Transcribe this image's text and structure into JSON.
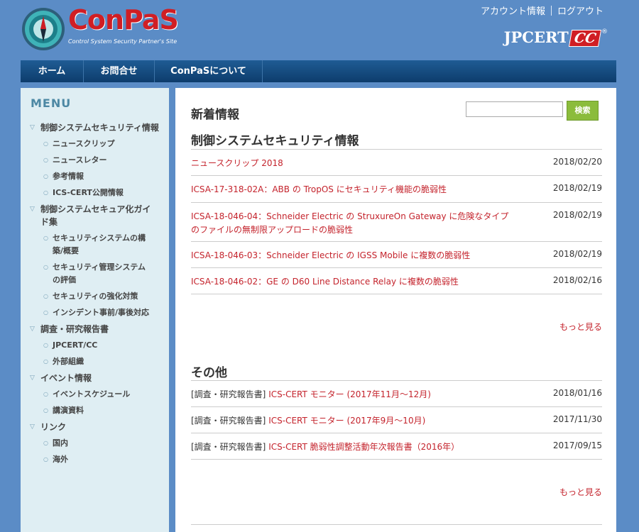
{
  "header": {
    "logo_title": "ConPaS",
    "logo_subtitle": "Control System Security Partner's Site",
    "account_link": "アカウント情報",
    "logout_link": "ログアウト",
    "jpcert_text": "JPCERT",
    "jpcert_cc": "CC",
    "jpcert_reg": "®"
  },
  "nav": {
    "home": "ホーム",
    "contact": "お問合せ",
    "about": "ConPaSについて"
  },
  "sidebar": {
    "title": "MENU",
    "categories": [
      {
        "label": "制御システムセキュリティ情報",
        "items": [
          "ニュースクリップ",
          "ニュースレター",
          "参考情報",
          "ICS-CERT公開情報"
        ]
      },
      {
        "label": "制御システムセキュア化ガイド集",
        "items": [
          "セキュリティシステムの構築/概要",
          "セキュリティ管理システムの評価",
          "セキュリティの強化対策",
          "インシデント事前/事後対応"
        ]
      },
      {
        "label": "調査・研究報告書",
        "items": [
          "JPCERT/CC",
          "外部組織"
        ]
      },
      {
        "label": "イベント情報",
        "items": [
          "イベントスケジュール",
          "講演資料"
        ]
      },
      {
        "label": "リンク",
        "items": [
          "国内",
          "海外"
        ]
      }
    ]
  },
  "main": {
    "title": "新着情報",
    "search_button": "検索",
    "search_value": "",
    "section1": {
      "title": "制御システムセキュリティ情報",
      "rows": [
        {
          "title": "ニュースクリップ 2018",
          "date": "2018/02/20"
        },
        {
          "title": "ICSA-17-318-02A：ABB の TropOS にセキュリティ機能の脆弱性",
          "date": "2018/02/19"
        },
        {
          "title": "ICSA-18-046-04：Schneider Electric の StruxureOn Gateway に危険なタイプのファイルの無制限アップロードの脆弱性",
          "date": "2018/02/19"
        },
        {
          "title": "ICSA-18-046-03：Schneider Electric の IGSS Mobile に複数の脆弱性",
          "date": "2018/02/19"
        },
        {
          "title": "ICSA-18-046-02：GE の D60 Line Distance Relay に複数の脆弱性",
          "date": "2018/02/16"
        }
      ],
      "more": "もっと見る"
    },
    "section2": {
      "title": "その他",
      "rows": [
        {
          "prefix": "[調査・研究報告書]",
          "title": "ICS-CERT モニター (2017年11月～12月)",
          "date": "2018/01/16"
        },
        {
          "prefix": "[調査・研究報告書]",
          "title": "ICS-CERT モニター (2017年9月～10月)",
          "date": "2017/11/30"
        },
        {
          "prefix": "[調査・研究報告書]",
          "title": "ICS-CERT 脆弱性調整活動年次報告書（2016年）",
          "date": "2017/09/15"
        }
      ],
      "more": "もっと見る"
    }
  }
}
